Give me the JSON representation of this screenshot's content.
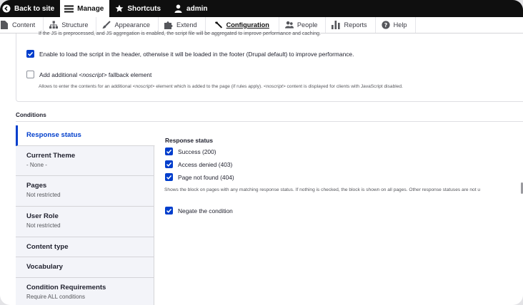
{
  "toolbar": {
    "back_label": "Back to site",
    "manage_label": "Manage",
    "shortcuts_label": "Shortcuts",
    "user_label": "admin"
  },
  "tray": {
    "items": [
      {
        "label": "Content",
        "icon": "file-icon"
      },
      {
        "label": "Structure",
        "icon": "sitemap-icon"
      },
      {
        "label": "Appearance",
        "icon": "paint-brush-icon"
      },
      {
        "label": "Extend",
        "icon": "puzzle-icon"
      },
      {
        "label": "Configuration",
        "icon": "wrench-icon",
        "active": true
      },
      {
        "label": "People",
        "icon": "people-icon"
      },
      {
        "label": "Reports",
        "icon": "bar-chart-icon"
      },
      {
        "label": "Help",
        "icon": "help-icon"
      }
    ]
  },
  "settings": {
    "cut_text": "If the JS is preprocessed, and JS aggregation is enabled, the script file will be aggregated to improve performance and caching.",
    "header_checkbox_label": "Enable to load the script in the header, otherwise it will be loaded in the footer (Drupal default) to improve performance.",
    "header_checked": true,
    "noscript_label_pre": "Add additional ",
    "noscript_label_em": "<noscript>",
    "noscript_label_post": " fallback element",
    "noscript_checked": false,
    "noscript_desc_1": "Allows to enter the contents for an additional ",
    "noscript_desc_em1": "<noscript>",
    "noscript_desc_2": " element which is added to the page (if rules apply). ",
    "noscript_desc_em2": "<noscript>",
    "noscript_desc_3": " content is displayed for clients with JavaScript disabled."
  },
  "conditions": {
    "title": "Conditions",
    "tabs": [
      {
        "title": "Response status",
        "summary": ""
      },
      {
        "title": "Current Theme",
        "summary": "- None -"
      },
      {
        "title": "Pages",
        "summary": "Not restricted"
      },
      {
        "title": "User Role",
        "summary": "Not restricted"
      },
      {
        "title": "Content type",
        "summary": ""
      },
      {
        "title": "Vocabulary",
        "summary": ""
      },
      {
        "title": "Condition Requirements",
        "summary": "Require ALL conditions"
      }
    ],
    "pane": {
      "title": "Response status",
      "options": [
        {
          "label": "Success (200)",
          "checked": true
        },
        {
          "label": "Access denied (403)",
          "checked": true
        },
        {
          "label": "Page not found (404)",
          "checked": true
        }
      ],
      "help": "Shows the block on pages with any matching response status. If nothing is checked, the block is shown on all pages. Other response statuses are not u",
      "negate_label": "Negate the condition",
      "negate_checked": true
    }
  },
  "colors": {
    "accent": "#003ecc",
    "toolbar_bg": "#0f0f0f"
  }
}
